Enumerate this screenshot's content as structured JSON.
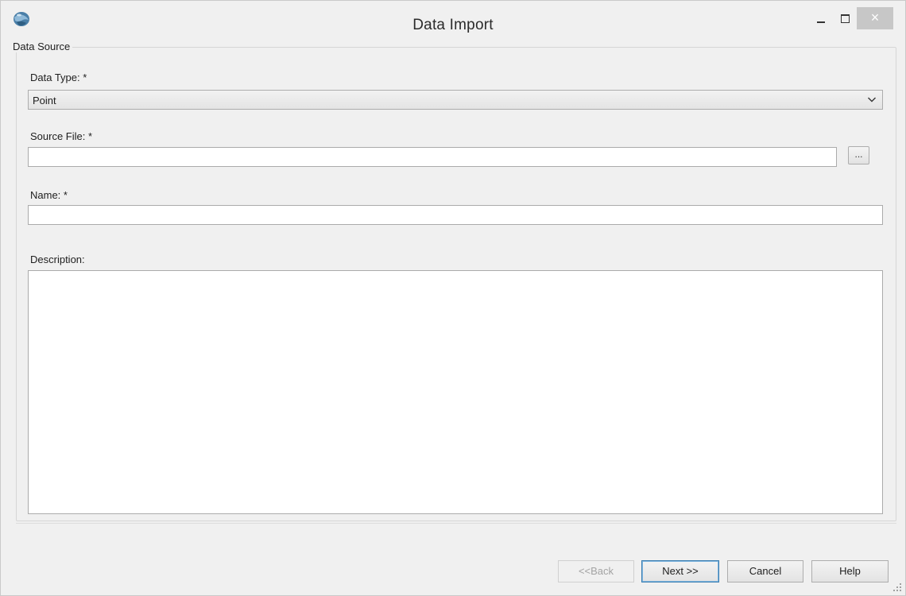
{
  "window": {
    "title": "Data Import",
    "close_glyph": "×",
    "icon": "app-globe-icon"
  },
  "groupbox": {
    "legend": "Data Source"
  },
  "fields": {
    "data_type": {
      "label": "Data Type: *",
      "value": "Point"
    },
    "source_file": {
      "label": "Source File: *",
      "value": "",
      "browse_label": "..."
    },
    "name": {
      "label": "Name: *",
      "value": ""
    },
    "description": {
      "label": "Description:",
      "value": ""
    }
  },
  "buttons": {
    "back": "<<Back",
    "next": "Next >>",
    "cancel": "Cancel",
    "help": "Help"
  },
  "colors": {
    "window_bg": "#f0f0f0",
    "close_button_bg": "#c7c7c7",
    "default_button_border": "#3c7fb1"
  }
}
